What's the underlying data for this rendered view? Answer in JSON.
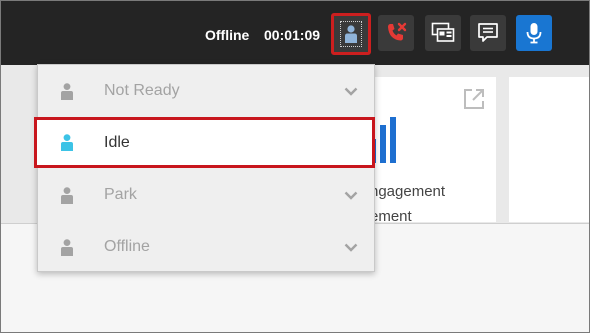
{
  "topbar": {
    "status": "Offline",
    "timer": "00:01:09"
  },
  "cards": {
    "card1_line1": "ngagement",
    "card1_line2": "ement"
  },
  "dropdown": {
    "items": [
      {
        "label": "Not Ready"
      },
      {
        "label": "Idle"
      },
      {
        "label": "Park"
      },
      {
        "label": "Offline"
      }
    ]
  },
  "colors": {
    "topbar": "#242424",
    "highlight_red": "#c8161d",
    "idle_cyan": "#3cc3e6",
    "mic_blue": "#1976d2"
  }
}
